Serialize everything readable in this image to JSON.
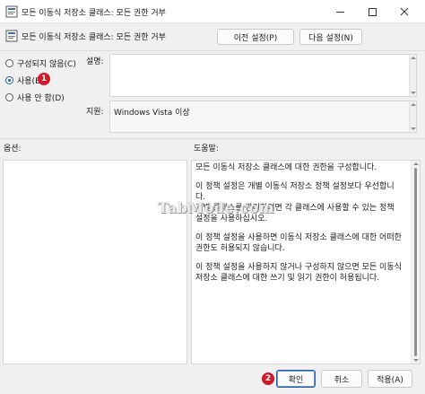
{
  "window": {
    "title": "모든 이동식 저장소 클래스: 모든 권한 거부",
    "app_icon": "policy-settings-icon",
    "controls": {
      "minimize": "minimize-icon",
      "maximize": "maximize-icon",
      "close": "close-icon"
    }
  },
  "header": {
    "policy_name": "모든 이동식 저장소 클래스: 모든 권한 거부",
    "prev_button": "이전 설정(P)",
    "next_button": "다음 설정(N)"
  },
  "state": {
    "options": [
      {
        "label": "구성되지 않음(C)",
        "selected": false
      },
      {
        "label": "사용(E)",
        "selected": true
      },
      {
        "label": "사용 안 함(D)",
        "selected": false
      }
    ]
  },
  "description": {
    "label": "설명:",
    "value": ""
  },
  "supported": {
    "label": "지원:",
    "value": "Windows Vista 이상"
  },
  "options_label": "옵션:",
  "help": {
    "label": "도움말:",
    "paragraphs": [
      "모든 이동식 저장소 클래스에 대한 권한을 구성합니다.",
      "이 정책 설정은 개별 이동식 저장소 정책 설정보다 우선합니다.\n개별 클래스를 관리하려면 각 클래스에 사용할 수 있는 정책 설정을 사용하십시오.",
      "이 정책 설정을 사용하면 이동식 저장소 클래스에 대한 어떠한 권한도 허용되지 않습니다.",
      "이 정책 설정을 사용하지 않거나 구성하지 않으면 모든 이동식 저장소 클래스에 대한 쓰기 및 읽기 권한이 허용됩니다."
    ]
  },
  "annotations": {
    "badge_1": "1",
    "badge_2": "2"
  },
  "watermark": "TabMode.com",
  "footer": {
    "ok": "확인",
    "cancel": "취소",
    "apply": "적용(A)"
  },
  "colors": {
    "accent": "#1a58a8",
    "badge": "#d0192a"
  }
}
